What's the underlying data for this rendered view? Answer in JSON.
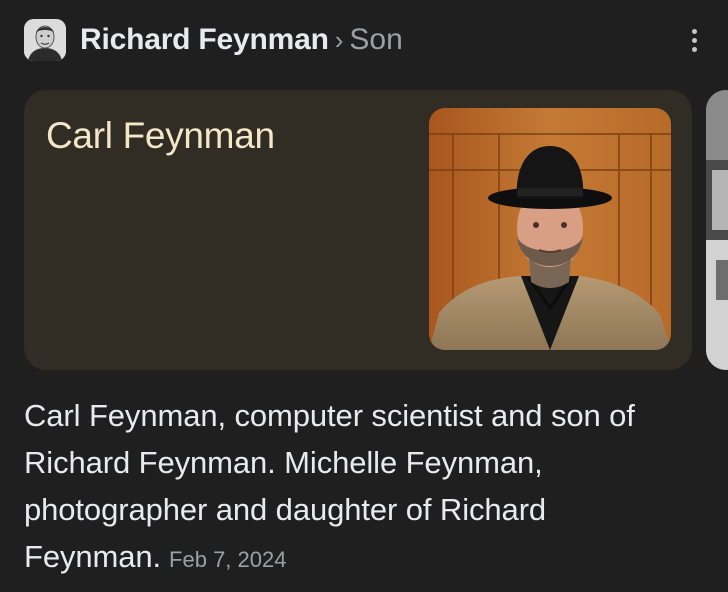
{
  "header": {
    "breadcrumb_main": "Richard Feynman",
    "breadcrumb_separator": "›",
    "breadcrumb_sub": "Son",
    "avatar_icon": "person-portrait-icon",
    "menu_icon": "more-vert-icon"
  },
  "card": {
    "title": "Carl Feynman",
    "photo": "photo-of-carl-feynman"
  },
  "description": {
    "text": "Carl Feynman, computer scientist and son of Richard Feynman. Michelle Feynman, photographer and daughter of Richard Feynman.",
    "date": "Feb 7, 2024"
  },
  "colors": {
    "background": "#1f1f1f",
    "card_background": "#312c24",
    "card_title": "#f3e7c8",
    "secondary_text": "#9aa0a6"
  }
}
